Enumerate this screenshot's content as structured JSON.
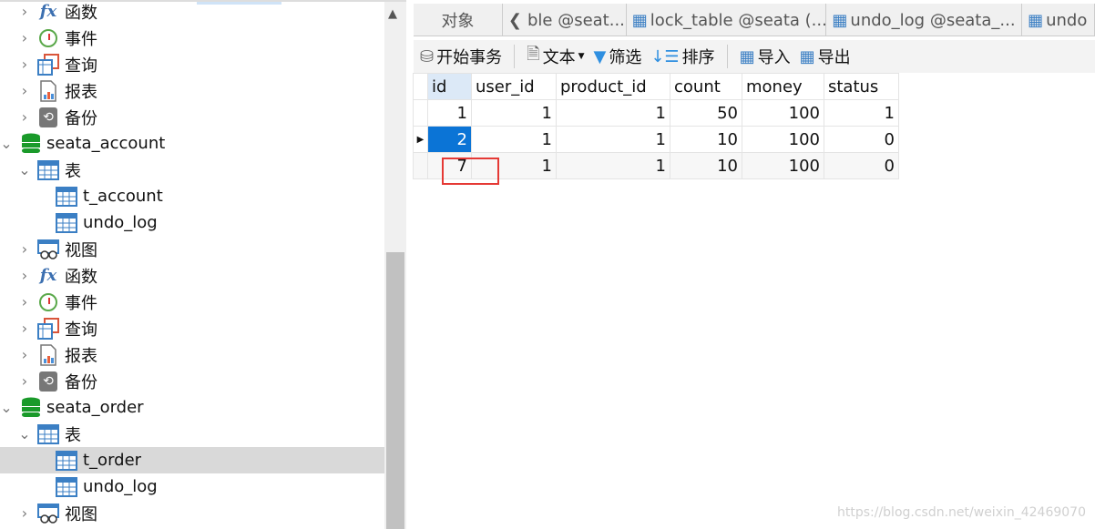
{
  "sidebar": {
    "items": [
      {
        "label": "函数",
        "icon": "function-icon",
        "level": 2,
        "expanded": false
      },
      {
        "label": "事件",
        "icon": "event-clock-icon",
        "level": 2,
        "expanded": false
      },
      {
        "label": "查询",
        "icon": "query-icon",
        "level": 2,
        "expanded": false
      },
      {
        "label": "报表",
        "icon": "report-icon",
        "level": 2,
        "expanded": false
      },
      {
        "label": "备份",
        "icon": "backup-icon",
        "level": 2,
        "expanded": false
      },
      {
        "label": "seata_account",
        "icon": "database-icon",
        "level": 1,
        "expanded": true
      },
      {
        "label": "表",
        "icon": "tables-icon",
        "level": 2,
        "expanded": true
      },
      {
        "label": "t_account",
        "icon": "table-icon",
        "level": 3
      },
      {
        "label": "undo_log",
        "icon": "table-icon",
        "level": 3
      },
      {
        "label": "视图",
        "icon": "view-icon",
        "level": 2,
        "expanded": false
      },
      {
        "label": "函数",
        "icon": "function-icon",
        "level": 2,
        "expanded": false
      },
      {
        "label": "事件",
        "icon": "event-clock-icon",
        "level": 2,
        "expanded": false
      },
      {
        "label": "查询",
        "icon": "query-icon",
        "level": 2,
        "expanded": false
      },
      {
        "label": "报表",
        "icon": "report-icon",
        "level": 2,
        "expanded": false
      },
      {
        "label": "备份",
        "icon": "backup-icon",
        "level": 2,
        "expanded": false
      },
      {
        "label": "seata_order",
        "icon": "database-icon",
        "level": 1,
        "expanded": true
      },
      {
        "label": "表",
        "icon": "tables-icon",
        "level": 2,
        "expanded": true
      },
      {
        "label": "t_order",
        "icon": "table-icon",
        "level": 3,
        "selected": true
      },
      {
        "label": "undo_log",
        "icon": "table-icon",
        "level": 3
      },
      {
        "label": "视图",
        "icon": "view-icon",
        "level": 2,
        "expanded": false
      }
    ]
  },
  "tabs": [
    "对象",
    "ble @seat...",
    "lock_table @seata (...",
    "undo_log @seata_...",
    "undo"
  ],
  "toolbar": {
    "begin_transaction": "开始事务",
    "text": "文本",
    "filter": "筛选",
    "sort": "排序",
    "import": "导入",
    "export": "导出"
  },
  "grid": {
    "columns": [
      "id",
      "user_id",
      "product_id",
      "count",
      "money",
      "status"
    ],
    "rows": [
      [
        "1",
        "1",
        "1",
        "50",
        "100",
        "1"
      ],
      [
        "2",
        "1",
        "1",
        "10",
        "100",
        "0"
      ],
      [
        "7",
        "1",
        "1",
        "10",
        "100",
        "0"
      ]
    ]
  },
  "watermark": "https://blog.csdn.net/weixin_42469070",
  "colors": {
    "selection": "#0b74d6",
    "highlight_box": "#e53935",
    "db_icon": "#1a9a2a"
  }
}
